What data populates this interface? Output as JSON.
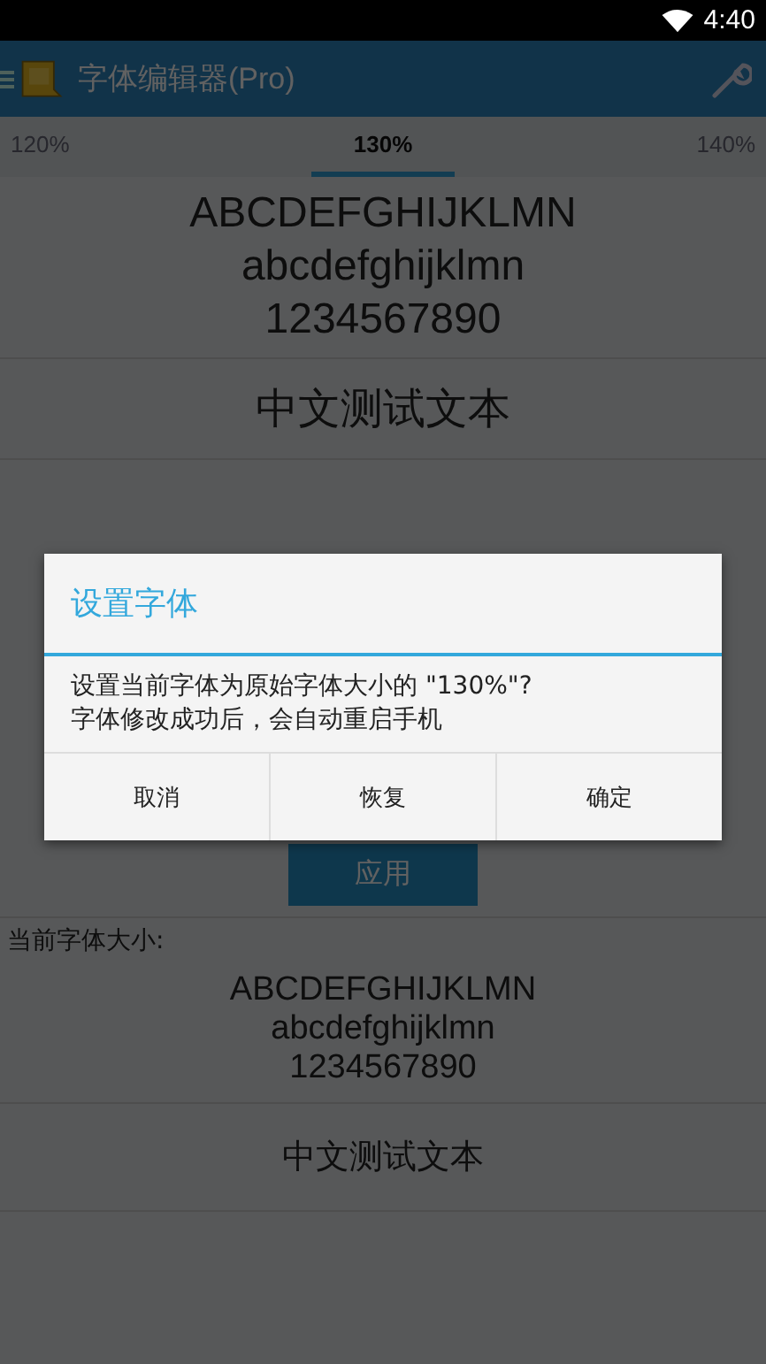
{
  "status_bar": {
    "time": "4:40"
  },
  "toolbar": {
    "title": "字体编辑器(Pro)"
  },
  "tabs": [
    {
      "label": "120%",
      "selected": false
    },
    {
      "label": "130%",
      "selected": true
    },
    {
      "label": "140%",
      "selected": false
    }
  ],
  "preview": {
    "lines": [
      "ABCDEFGHIJKLMN",
      "abcdefghijklmn",
      "1234567890"
    ],
    "chinese": "中文测试文本"
  },
  "apply_button": "应用",
  "current_size": {
    "label": "当前字体大小:",
    "lines": [
      "ABCDEFGHIJKLMN",
      "abcdefghijklmn",
      "1234567890"
    ],
    "chinese": "中文测试文本"
  },
  "dialog": {
    "title": "设置字体",
    "message": [
      "设置当前字体为原始字体大小的 \"130%\"?",
      "字体修改成功后，会自动重启手机"
    ],
    "buttons": [
      "取消",
      "恢复",
      "确定"
    ]
  }
}
